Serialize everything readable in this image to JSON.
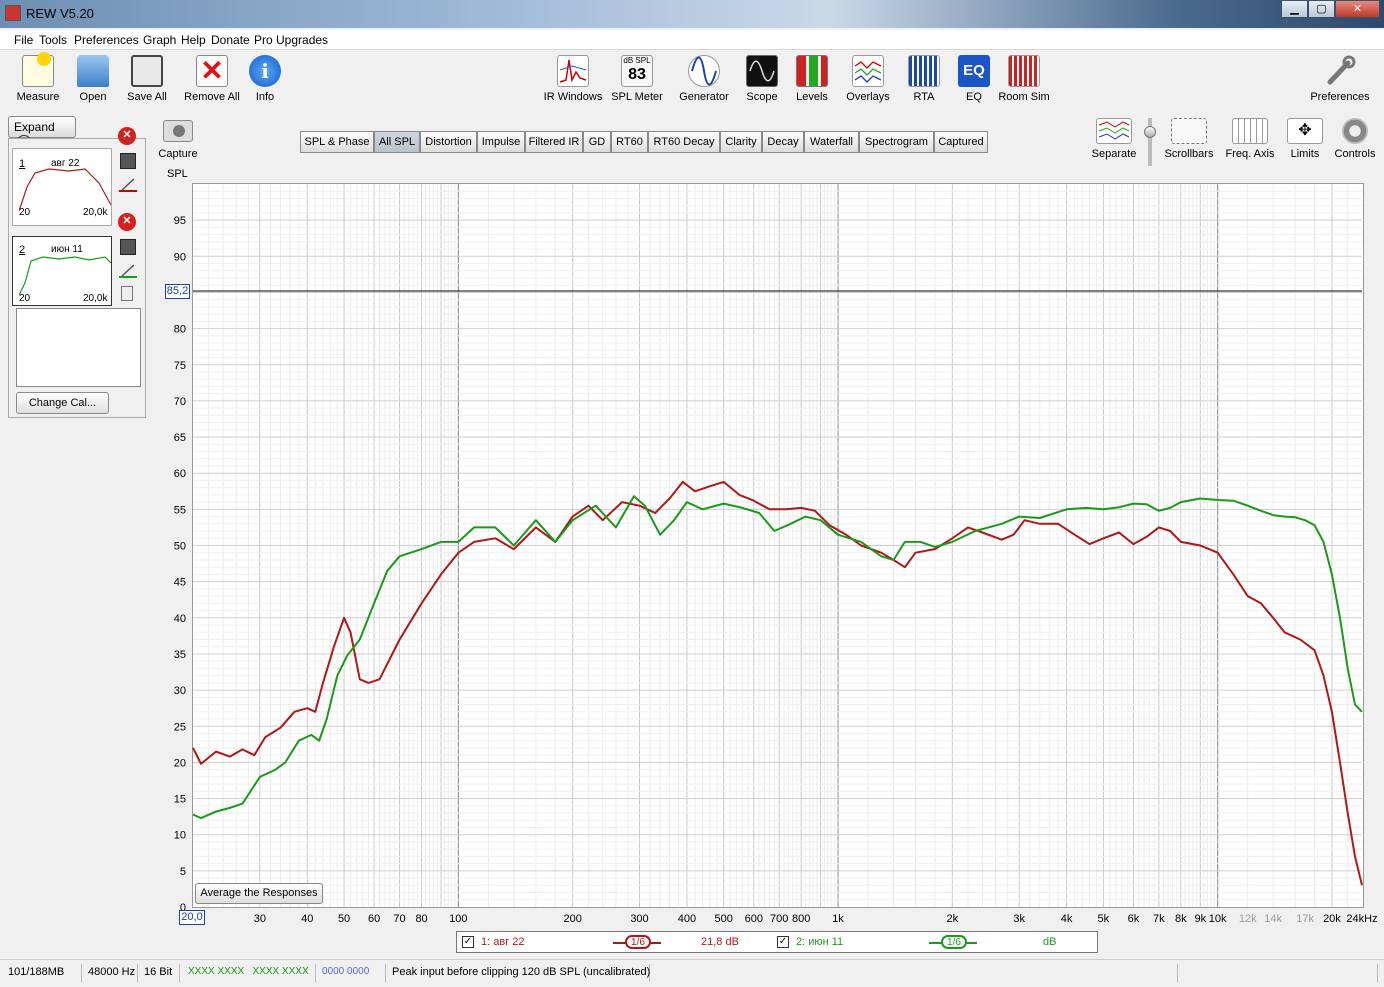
{
  "window": {
    "title": "REW V5.20",
    "controls": {
      "minimize": "▁",
      "maximize": "▢",
      "close": "✕"
    }
  },
  "menu": [
    "File",
    "Tools",
    "Preferences",
    "Graph",
    "Help",
    "Donate",
    "Pro Upgrades"
  ],
  "toolbar_left": [
    {
      "label": "Measure",
      "icon": "measure-icon"
    },
    {
      "label": "Open",
      "icon": "folder-icon"
    },
    {
      "label": "Save All",
      "icon": "save-icon"
    },
    {
      "label": "Remove All",
      "icon": "remove-icon"
    },
    {
      "label": "Info",
      "icon": "info-icon"
    }
  ],
  "toolbar_center": [
    {
      "label": "IR Windows",
      "icon": "ir-windows-icon"
    },
    {
      "label": "SPL Meter",
      "icon": "spl-meter-icon",
      "badge_top": "dB SPL",
      "badge_value": "83"
    },
    {
      "label": "Generator",
      "icon": "generator-icon"
    },
    {
      "label": "Scope",
      "icon": "scope-icon"
    },
    {
      "label": "Levels",
      "icon": "levels-icon"
    },
    {
      "label": "Overlays",
      "icon": "overlays-icon"
    },
    {
      "label": "RTA",
      "icon": "rta-icon"
    },
    {
      "label": "EQ",
      "icon": "eq-icon"
    },
    {
      "label": "Room Sim",
      "icon": "room-sim-icon"
    }
  ],
  "toolbar_right": {
    "label": "Preferences",
    "icon": "wrench-icon"
  },
  "graph_tools": [
    {
      "label": "Separate",
      "icon": "separate-icon"
    },
    {
      "label": "Scrollbars",
      "icon": "scrollbars-icon"
    },
    {
      "label": "Freq. Axis",
      "icon": "freq-axis-icon"
    },
    {
      "label": "Limits",
      "icon": "limits-icon"
    },
    {
      "label": "Controls",
      "icon": "gear-icon"
    }
  ],
  "capture": {
    "label": "Capture"
  },
  "expand": {
    "label": "Expand",
    "icon": "chevron-right-icon"
  },
  "measurements": [
    {
      "index": "1",
      "name": "авг 22",
      "xmin": "20",
      "xmax": "20,0k",
      "color": "#b01818"
    },
    {
      "index": "2",
      "name": "июн 11",
      "xmin": "20",
      "xmax": "20,0k",
      "color": "#1a9a1a"
    }
  ],
  "change_cal": "Change Cal...",
  "tabs": [
    "SPL & Phase",
    "All SPL",
    "Distortion",
    "Impulse",
    "Filtered IR",
    "GD",
    "RT60",
    "RT60 Decay",
    "Clarity",
    "Decay",
    "Waterfall",
    "Spectrogram",
    "Captured"
  ],
  "active_tab": "All SPL",
  "average_button": "Average the Responses",
  "cursor": {
    "y_value": "85,2",
    "x_value": "20,0"
  },
  "chart_data": {
    "type": "line",
    "ylabel": "SPL",
    "ylim": [
      0,
      100
    ],
    "xlim": [
      20,
      24000
    ],
    "xscale": "log",
    "y_ticks": [
      0,
      5,
      10,
      15,
      20,
      25,
      30,
      35,
      40,
      45,
      50,
      55,
      60,
      65,
      70,
      75,
      80,
      85,
      90,
      95
    ],
    "x_ticks": [
      {
        "v": 30,
        "t": "30"
      },
      {
        "v": 40,
        "t": "40"
      },
      {
        "v": 50,
        "t": "50"
      },
      {
        "v": 60,
        "t": "60"
      },
      {
        "v": 70,
        "t": "70"
      },
      {
        "v": 80,
        "t": "80"
      },
      {
        "v": 100,
        "t": "100"
      },
      {
        "v": 200,
        "t": "200"
      },
      {
        "v": 300,
        "t": "300"
      },
      {
        "v": 400,
        "t": "400"
      },
      {
        "v": 500,
        "t": "500"
      },
      {
        "v": 600,
        "t": "600"
      },
      {
        "v": 700,
        "t": "700"
      },
      {
        "v": 800,
        "t": "800"
      },
      {
        "v": 1000,
        "t": "1k"
      },
      {
        "v": 2000,
        "t": "2k"
      },
      {
        "v": 3000,
        "t": "3k"
      },
      {
        "v": 4000,
        "t": "4k"
      },
      {
        "v": 5000,
        "t": "5k"
      },
      {
        "v": 6000,
        "t": "6k"
      },
      {
        "v": 7000,
        "t": "7k"
      },
      {
        "v": 8000,
        "t": "8k"
      },
      {
        "v": 9000,
        "t": "9k"
      },
      {
        "v": 10000,
        "t": "10k"
      },
      {
        "v": 12000,
        "t": "12k",
        "dim": true
      },
      {
        "v": 14000,
        "t": "14k",
        "dim": true
      },
      {
        "v": 17000,
        "t": "17k",
        "dim": true
      },
      {
        "v": 20000,
        "t": "20k"
      },
      {
        "v": 24000,
        "t": "24kHz"
      }
    ],
    "series": [
      {
        "name": "1: авг 22",
        "color": "#b01818",
        "points": [
          [
            20,
            22
          ],
          [
            21,
            19.8
          ],
          [
            23,
            21.5
          ],
          [
            25,
            20.8
          ],
          [
            27,
            21.8
          ],
          [
            29,
            21
          ],
          [
            31,
            23.5
          ],
          [
            34,
            24.8
          ],
          [
            37,
            27
          ],
          [
            40,
            27.5
          ],
          [
            42,
            27
          ],
          [
            44,
            31
          ],
          [
            47,
            36
          ],
          [
            50,
            40
          ],
          [
            52,
            38
          ],
          [
            55,
            31.5
          ],
          [
            58,
            31
          ],
          [
            62,
            31.5
          ],
          [
            70,
            37
          ],
          [
            80,
            42
          ],
          [
            90,
            46
          ],
          [
            100,
            49
          ],
          [
            110,
            50.5
          ],
          [
            125,
            51
          ],
          [
            140,
            49.5
          ],
          [
            160,
            52.5
          ],
          [
            180,
            50.5
          ],
          [
            200,
            54
          ],
          [
            220,
            55.5
          ],
          [
            240,
            53.5
          ],
          [
            270,
            56
          ],
          [
            300,
            55.5
          ],
          [
            330,
            54.5
          ],
          [
            360,
            56.5
          ],
          [
            390,
            58.8
          ],
          [
            420,
            57.5
          ],
          [
            460,
            58.2
          ],
          [
            500,
            58.8
          ],
          [
            550,
            57
          ],
          [
            600,
            56.2
          ],
          [
            660,
            55
          ],
          [
            730,
            55
          ],
          [
            800,
            55.2
          ],
          [
            870,
            54.8
          ],
          [
            950,
            52.8
          ],
          [
            1050,
            51.5
          ],
          [
            1150,
            50
          ],
          [
            1300,
            49
          ],
          [
            1400,
            48
          ],
          [
            1500,
            47
          ],
          [
            1600,
            49
          ],
          [
            1800,
            49.5
          ],
          [
            2000,
            51
          ],
          [
            2200,
            52.5
          ],
          [
            2400,
            51.8
          ],
          [
            2700,
            50.8
          ],
          [
            2900,
            51.5
          ],
          [
            3100,
            53.5
          ],
          [
            3400,
            53
          ],
          [
            3800,
            53
          ],
          [
            4200,
            51.5
          ],
          [
            4600,
            50.2
          ],
          [
            5000,
            51
          ],
          [
            5500,
            51.8
          ],
          [
            6000,
            50.2
          ],
          [
            6500,
            51.2
          ],
          [
            7000,
            52.5
          ],
          [
            7500,
            52
          ],
          [
            8000,
            50.5
          ],
          [
            9000,
            50
          ],
          [
            10000,
            49
          ],
          [
            11000,
            46
          ],
          [
            12000,
            43
          ],
          [
            13000,
            42
          ],
          [
            14000,
            40
          ],
          [
            15000,
            38
          ],
          [
            16500,
            37
          ],
          [
            18000,
            35.5
          ],
          [
            19000,
            32
          ],
          [
            20000,
            27
          ],
          [
            21000,
            20
          ],
          [
            22000,
            13
          ],
          [
            23000,
            7
          ],
          [
            24000,
            3
          ]
        ]
      },
      {
        "name": "2: июн 11",
        "color": "#1a9a1a",
        "points": [
          [
            20,
            12.8
          ],
          [
            21,
            12.3
          ],
          [
            23,
            13.2
          ],
          [
            25,
            13.7
          ],
          [
            27,
            14.3
          ],
          [
            30,
            18
          ],
          [
            33,
            19
          ],
          [
            35,
            20
          ],
          [
            38,
            23
          ],
          [
            41,
            23.8
          ],
          [
            43,
            23
          ],
          [
            45,
            26
          ],
          [
            48,
            32
          ],
          [
            51,
            34.8
          ],
          [
            55,
            37
          ],
          [
            60,
            42
          ],
          [
            65,
            46.5
          ],
          [
            70,
            48.5
          ],
          [
            80,
            49.5
          ],
          [
            90,
            50.5
          ],
          [
            100,
            50.5
          ],
          [
            110,
            52.5
          ],
          [
            125,
            52.5
          ],
          [
            140,
            50
          ],
          [
            160,
            53.5
          ],
          [
            180,
            50.5
          ],
          [
            200,
            53.5
          ],
          [
            230,
            55.5
          ],
          [
            260,
            52.5
          ],
          [
            290,
            56.8
          ],
          [
            310,
            55.5
          ],
          [
            340,
            51.5
          ],
          [
            370,
            53.5
          ],
          [
            400,
            56
          ],
          [
            440,
            55
          ],
          [
            500,
            55.8
          ],
          [
            560,
            55.2
          ],
          [
            620,
            54.5
          ],
          [
            680,
            52
          ],
          [
            750,
            53
          ],
          [
            820,
            54
          ],
          [
            900,
            53.5
          ],
          [
            1000,
            51.5
          ],
          [
            1150,
            50.5
          ],
          [
            1300,
            48.5
          ],
          [
            1400,
            48
          ],
          [
            1500,
            50.5
          ],
          [
            1650,
            50.5
          ],
          [
            1800,
            49.8
          ],
          [
            2000,
            50.5
          ],
          [
            2300,
            52
          ],
          [
            2700,
            53
          ],
          [
            3000,
            54
          ],
          [
            3400,
            53.8
          ],
          [
            4000,
            55
          ],
          [
            4500,
            55.2
          ],
          [
            5000,
            55
          ],
          [
            5500,
            55.3
          ],
          [
            6000,
            55.8
          ],
          [
            6500,
            55.7
          ],
          [
            7000,
            54.8
          ],
          [
            7500,
            55.2
          ],
          [
            8000,
            56
          ],
          [
            9000,
            56.5
          ],
          [
            10000,
            56.3
          ],
          [
            11000,
            56.2
          ],
          [
            12000,
            55.5
          ],
          [
            13000,
            54.8
          ],
          [
            14000,
            54.2
          ],
          [
            15000,
            54
          ],
          [
            16000,
            53.9
          ],
          [
            17000,
            53.5
          ],
          [
            18000,
            52.8
          ],
          [
            19000,
            50.5
          ],
          [
            20000,
            46
          ],
          [
            21000,
            40
          ],
          [
            22000,
            33
          ],
          [
            23000,
            28
          ],
          [
            24000,
            27
          ]
        ]
      }
    ]
  },
  "legend": {
    "s1_label": "1: авг 22",
    "s1_smoothing": "1/6",
    "s1_value": "21,8 dB",
    "s2_label": "2: июн 11",
    "s2_smoothing": "1/6",
    "s2_value": "dB"
  },
  "status": {
    "memory": "101/188MB",
    "rate": "48000 Hz",
    "bits": "16 Bit",
    "green_levels": "XXXX XXXX   XXXX XXXX",
    "blue_levels": "0000 0000",
    "message": "Peak input before clipping 120 dB SPL (uncalibrated)"
  }
}
